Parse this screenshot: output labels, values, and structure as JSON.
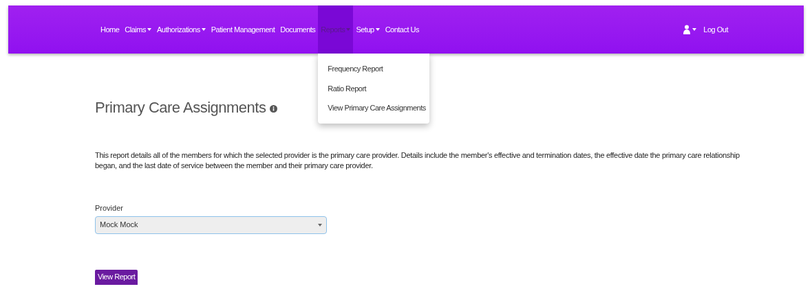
{
  "nav": {
    "items": [
      {
        "label": "Home",
        "has_menu": false,
        "selected": false
      },
      {
        "label": "Claims",
        "has_menu": true,
        "selected": false
      },
      {
        "label": "Authorizations",
        "has_menu": true,
        "selected": false
      },
      {
        "label": "Patient Management",
        "has_menu": false,
        "selected": false
      },
      {
        "label": "Documents",
        "has_menu": false,
        "selected": false
      },
      {
        "label": "Reports",
        "has_menu": true,
        "selected": true
      },
      {
        "label": "Setup",
        "has_menu": true,
        "selected": false
      },
      {
        "label": "Contact Us",
        "has_menu": false,
        "selected": false
      }
    ],
    "logout": "Log Out"
  },
  "dropdown": {
    "items": [
      "Frequency Report",
      "Ratio Report",
      "View Primary Care Assignments"
    ]
  },
  "page": {
    "title": "Primary Care Assignments",
    "description": "This report details all of the members for which the selected provider is the primary care provider. Details include the member's effective and termination dates, the effective date the primary care relationship began, and the last date of service between the member and their primary care provider.",
    "provider_label": "Provider",
    "provider_value": "Mock Mock",
    "button": "View Report"
  }
}
